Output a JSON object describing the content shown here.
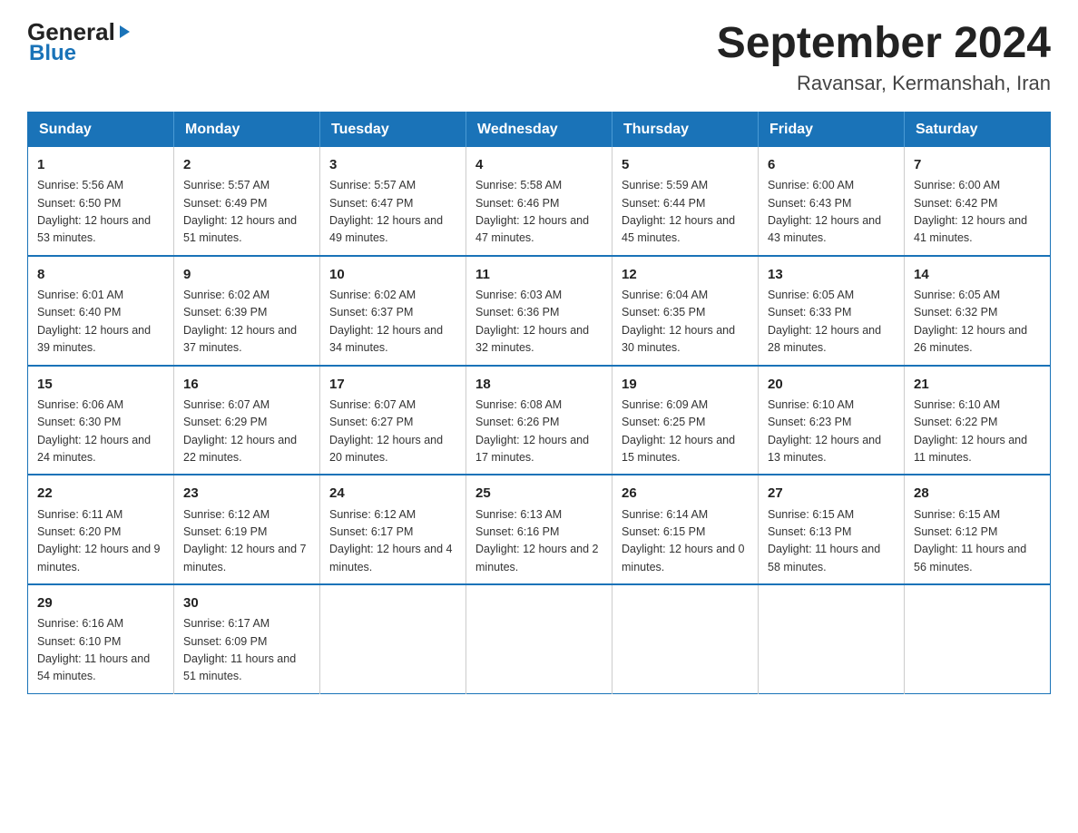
{
  "header": {
    "logo_general": "General",
    "logo_blue": "Blue",
    "month_title": "September 2024",
    "subtitle": "Ravansar, Kermanshah, Iran"
  },
  "days_of_week": [
    "Sunday",
    "Monday",
    "Tuesday",
    "Wednesday",
    "Thursday",
    "Friday",
    "Saturday"
  ],
  "weeks": [
    [
      {
        "day": "1",
        "sunrise": "Sunrise: 5:56 AM",
        "sunset": "Sunset: 6:50 PM",
        "daylight": "Daylight: 12 hours and 53 minutes."
      },
      {
        "day": "2",
        "sunrise": "Sunrise: 5:57 AM",
        "sunset": "Sunset: 6:49 PM",
        "daylight": "Daylight: 12 hours and 51 minutes."
      },
      {
        "day": "3",
        "sunrise": "Sunrise: 5:57 AM",
        "sunset": "Sunset: 6:47 PM",
        "daylight": "Daylight: 12 hours and 49 minutes."
      },
      {
        "day": "4",
        "sunrise": "Sunrise: 5:58 AM",
        "sunset": "Sunset: 6:46 PM",
        "daylight": "Daylight: 12 hours and 47 minutes."
      },
      {
        "day": "5",
        "sunrise": "Sunrise: 5:59 AM",
        "sunset": "Sunset: 6:44 PM",
        "daylight": "Daylight: 12 hours and 45 minutes."
      },
      {
        "day": "6",
        "sunrise": "Sunrise: 6:00 AM",
        "sunset": "Sunset: 6:43 PM",
        "daylight": "Daylight: 12 hours and 43 minutes."
      },
      {
        "day": "7",
        "sunrise": "Sunrise: 6:00 AM",
        "sunset": "Sunset: 6:42 PM",
        "daylight": "Daylight: 12 hours and 41 minutes."
      }
    ],
    [
      {
        "day": "8",
        "sunrise": "Sunrise: 6:01 AM",
        "sunset": "Sunset: 6:40 PM",
        "daylight": "Daylight: 12 hours and 39 minutes."
      },
      {
        "day": "9",
        "sunrise": "Sunrise: 6:02 AM",
        "sunset": "Sunset: 6:39 PM",
        "daylight": "Daylight: 12 hours and 37 minutes."
      },
      {
        "day": "10",
        "sunrise": "Sunrise: 6:02 AM",
        "sunset": "Sunset: 6:37 PM",
        "daylight": "Daylight: 12 hours and 34 minutes."
      },
      {
        "day": "11",
        "sunrise": "Sunrise: 6:03 AM",
        "sunset": "Sunset: 6:36 PM",
        "daylight": "Daylight: 12 hours and 32 minutes."
      },
      {
        "day": "12",
        "sunrise": "Sunrise: 6:04 AM",
        "sunset": "Sunset: 6:35 PM",
        "daylight": "Daylight: 12 hours and 30 minutes."
      },
      {
        "day": "13",
        "sunrise": "Sunrise: 6:05 AM",
        "sunset": "Sunset: 6:33 PM",
        "daylight": "Daylight: 12 hours and 28 minutes."
      },
      {
        "day": "14",
        "sunrise": "Sunrise: 6:05 AM",
        "sunset": "Sunset: 6:32 PM",
        "daylight": "Daylight: 12 hours and 26 minutes."
      }
    ],
    [
      {
        "day": "15",
        "sunrise": "Sunrise: 6:06 AM",
        "sunset": "Sunset: 6:30 PM",
        "daylight": "Daylight: 12 hours and 24 minutes."
      },
      {
        "day": "16",
        "sunrise": "Sunrise: 6:07 AM",
        "sunset": "Sunset: 6:29 PM",
        "daylight": "Daylight: 12 hours and 22 minutes."
      },
      {
        "day": "17",
        "sunrise": "Sunrise: 6:07 AM",
        "sunset": "Sunset: 6:27 PM",
        "daylight": "Daylight: 12 hours and 20 minutes."
      },
      {
        "day": "18",
        "sunrise": "Sunrise: 6:08 AM",
        "sunset": "Sunset: 6:26 PM",
        "daylight": "Daylight: 12 hours and 17 minutes."
      },
      {
        "day": "19",
        "sunrise": "Sunrise: 6:09 AM",
        "sunset": "Sunset: 6:25 PM",
        "daylight": "Daylight: 12 hours and 15 minutes."
      },
      {
        "day": "20",
        "sunrise": "Sunrise: 6:10 AM",
        "sunset": "Sunset: 6:23 PM",
        "daylight": "Daylight: 12 hours and 13 minutes."
      },
      {
        "day": "21",
        "sunrise": "Sunrise: 6:10 AM",
        "sunset": "Sunset: 6:22 PM",
        "daylight": "Daylight: 12 hours and 11 minutes."
      }
    ],
    [
      {
        "day": "22",
        "sunrise": "Sunrise: 6:11 AM",
        "sunset": "Sunset: 6:20 PM",
        "daylight": "Daylight: 12 hours and 9 minutes."
      },
      {
        "day": "23",
        "sunrise": "Sunrise: 6:12 AM",
        "sunset": "Sunset: 6:19 PM",
        "daylight": "Daylight: 12 hours and 7 minutes."
      },
      {
        "day": "24",
        "sunrise": "Sunrise: 6:12 AM",
        "sunset": "Sunset: 6:17 PM",
        "daylight": "Daylight: 12 hours and 4 minutes."
      },
      {
        "day": "25",
        "sunrise": "Sunrise: 6:13 AM",
        "sunset": "Sunset: 6:16 PM",
        "daylight": "Daylight: 12 hours and 2 minutes."
      },
      {
        "day": "26",
        "sunrise": "Sunrise: 6:14 AM",
        "sunset": "Sunset: 6:15 PM",
        "daylight": "Daylight: 12 hours and 0 minutes."
      },
      {
        "day": "27",
        "sunrise": "Sunrise: 6:15 AM",
        "sunset": "Sunset: 6:13 PM",
        "daylight": "Daylight: 11 hours and 58 minutes."
      },
      {
        "day": "28",
        "sunrise": "Sunrise: 6:15 AM",
        "sunset": "Sunset: 6:12 PM",
        "daylight": "Daylight: 11 hours and 56 minutes."
      }
    ],
    [
      {
        "day": "29",
        "sunrise": "Sunrise: 6:16 AM",
        "sunset": "Sunset: 6:10 PM",
        "daylight": "Daylight: 11 hours and 54 minutes."
      },
      {
        "day": "30",
        "sunrise": "Sunrise: 6:17 AM",
        "sunset": "Sunset: 6:09 PM",
        "daylight": "Daylight: 11 hours and 51 minutes."
      },
      null,
      null,
      null,
      null,
      null
    ]
  ]
}
